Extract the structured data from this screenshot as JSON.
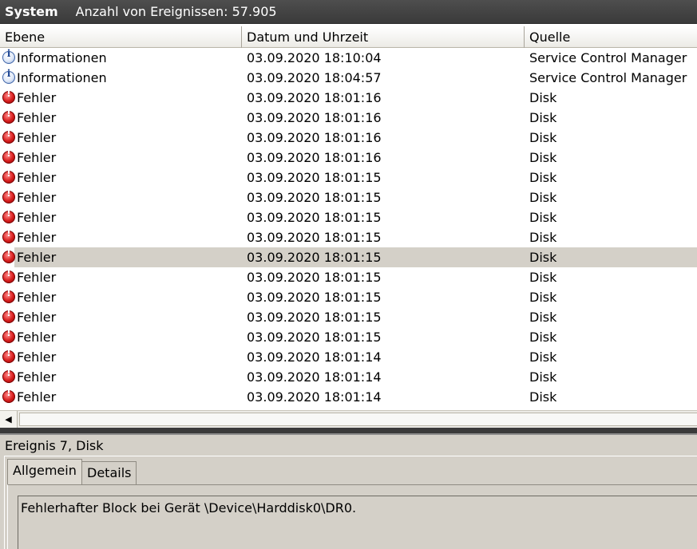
{
  "header": {
    "title": "System",
    "count_label": "Anzahl von Ereignissen: 57.905"
  },
  "columns": {
    "level": "Ebene",
    "date": "Datum und Uhrzeit",
    "source": "Quelle"
  },
  "rows": [
    {
      "icon": "info-icon",
      "level": "Informationen",
      "date": "03.09.2020 18:10:04",
      "source": "Service Control Manager",
      "selected": false
    },
    {
      "icon": "info-icon",
      "level": "Informationen",
      "date": "03.09.2020 18:04:57",
      "source": "Service Control Manager",
      "selected": false
    },
    {
      "icon": "error-icon",
      "level": "Fehler",
      "date": "03.09.2020 18:01:16",
      "source": "Disk",
      "selected": false
    },
    {
      "icon": "error-icon",
      "level": "Fehler",
      "date": "03.09.2020 18:01:16",
      "source": "Disk",
      "selected": false
    },
    {
      "icon": "error-icon",
      "level": "Fehler",
      "date": "03.09.2020 18:01:16",
      "source": "Disk",
      "selected": false
    },
    {
      "icon": "error-icon",
      "level": "Fehler",
      "date": "03.09.2020 18:01:16",
      "source": "Disk",
      "selected": false
    },
    {
      "icon": "error-icon",
      "level": "Fehler",
      "date": "03.09.2020 18:01:15",
      "source": "Disk",
      "selected": false
    },
    {
      "icon": "error-icon",
      "level": "Fehler",
      "date": "03.09.2020 18:01:15",
      "source": "Disk",
      "selected": false
    },
    {
      "icon": "error-icon",
      "level": "Fehler",
      "date": "03.09.2020 18:01:15",
      "source": "Disk",
      "selected": false
    },
    {
      "icon": "error-icon",
      "level": "Fehler",
      "date": "03.09.2020 18:01:15",
      "source": "Disk",
      "selected": false
    },
    {
      "icon": "error-icon",
      "level": "Fehler",
      "date": "03.09.2020 18:01:15",
      "source": "Disk",
      "selected": true
    },
    {
      "icon": "error-icon",
      "level": "Fehler",
      "date": "03.09.2020 18:01:15",
      "source": "Disk",
      "selected": false
    },
    {
      "icon": "error-icon",
      "level": "Fehler",
      "date": "03.09.2020 18:01:15",
      "source": "Disk",
      "selected": false
    },
    {
      "icon": "error-icon",
      "level": "Fehler",
      "date": "03.09.2020 18:01:15",
      "source": "Disk",
      "selected": false
    },
    {
      "icon": "error-icon",
      "level": "Fehler",
      "date": "03.09.2020 18:01:15",
      "source": "Disk",
      "selected": false
    },
    {
      "icon": "error-icon",
      "level": "Fehler",
      "date": "03.09.2020 18:01:14",
      "source": "Disk",
      "selected": false
    },
    {
      "icon": "error-icon",
      "level": "Fehler",
      "date": "03.09.2020 18:01:14",
      "source": "Disk",
      "selected": false
    },
    {
      "icon": "error-icon",
      "level": "Fehler",
      "date": "03.09.2020 18:01:14",
      "source": "Disk",
      "selected": false
    }
  ],
  "scrollbar": {
    "left_arrow": "◀"
  },
  "detail": {
    "title": "Ereignis 7, Disk",
    "tabs": [
      {
        "label": "Allgemein",
        "active": true
      },
      {
        "label": "Details",
        "active": false
      }
    ],
    "message": "Fehlerhafter Block bei Gerät \\Device\\Harddisk0\\DR0."
  },
  "colors": {
    "header_bg": "#3a3a3a",
    "selected_row": "#d4d0c8",
    "panel_bg": "#d4d0c8",
    "error_red": "#d81e1e",
    "info_blue": "#3e64a8"
  }
}
